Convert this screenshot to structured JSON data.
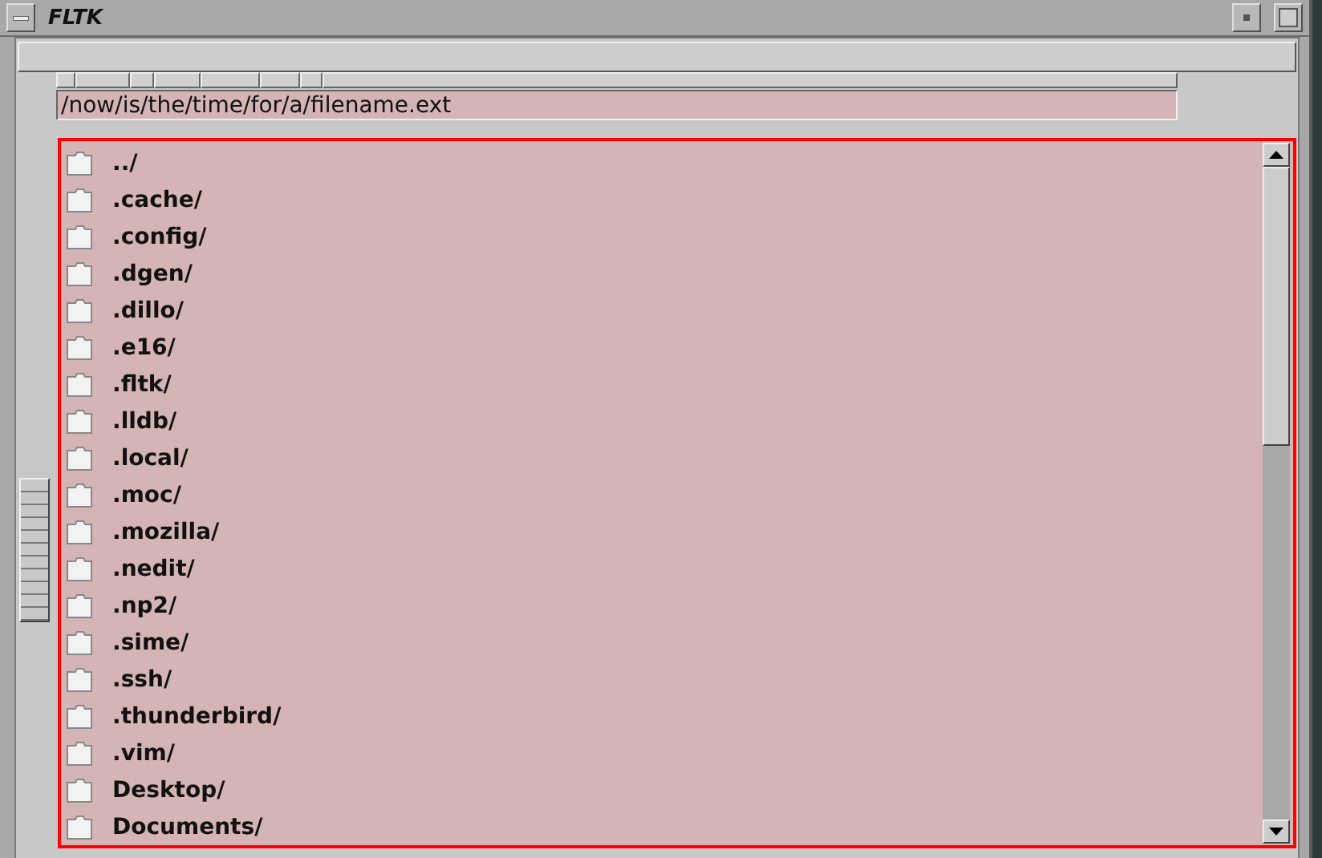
{
  "window": {
    "title": "FLTK"
  },
  "path_field": {
    "value": "/now/is/the/time/for/a/filename.ext"
  },
  "slider": {
    "level": 0.6
  },
  "file_list": [
    {
      "name": "../"
    },
    {
      "name": ".cache/"
    },
    {
      "name": ".config/"
    },
    {
      "name": ".dgen/"
    },
    {
      "name": ".dillo/"
    },
    {
      "name": ".e16/"
    },
    {
      "name": ".fltk/"
    },
    {
      "name": ".lldb/"
    },
    {
      "name": ".local/"
    },
    {
      "name": ".moc/"
    },
    {
      "name": ".mozilla/"
    },
    {
      "name": ".nedit/"
    },
    {
      "name": ".np2/"
    },
    {
      "name": ".sime/"
    },
    {
      "name": ".ssh/"
    },
    {
      "name": ".thunderbird/"
    },
    {
      "name": ".vim/"
    },
    {
      "name": "Desktop/"
    },
    {
      "name": "Documents/"
    }
  ]
}
